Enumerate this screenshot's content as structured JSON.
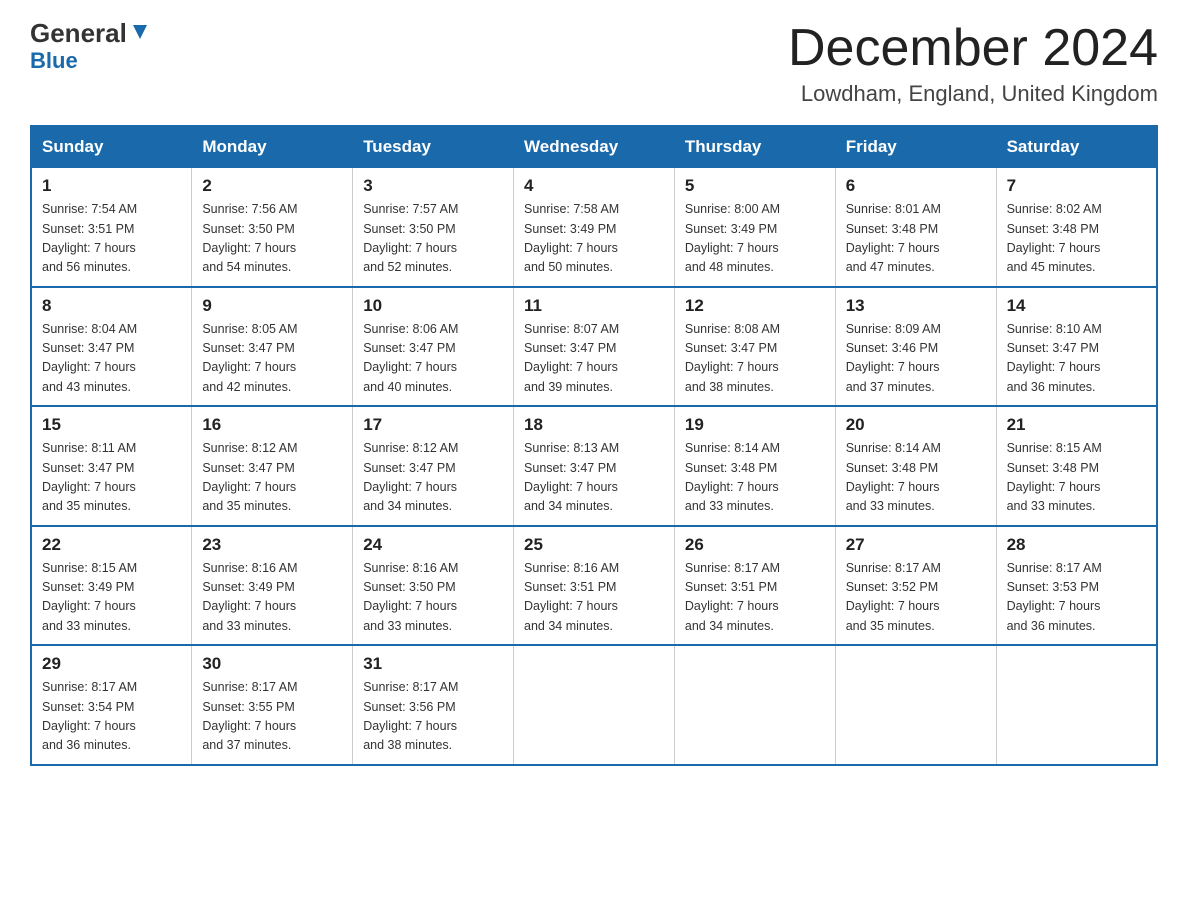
{
  "logo": {
    "line1_black": "General",
    "line1_blue": "Blue",
    "line2": "Blue"
  },
  "header": {
    "title": "December 2024",
    "subtitle": "Lowdham, England, United Kingdom"
  },
  "weekdays": [
    "Sunday",
    "Monday",
    "Tuesday",
    "Wednesday",
    "Thursday",
    "Friday",
    "Saturday"
  ],
  "weeks": [
    [
      {
        "day": "1",
        "info": "Sunrise: 7:54 AM\nSunset: 3:51 PM\nDaylight: 7 hours\nand 56 minutes."
      },
      {
        "day": "2",
        "info": "Sunrise: 7:56 AM\nSunset: 3:50 PM\nDaylight: 7 hours\nand 54 minutes."
      },
      {
        "day": "3",
        "info": "Sunrise: 7:57 AM\nSunset: 3:50 PM\nDaylight: 7 hours\nand 52 minutes."
      },
      {
        "day": "4",
        "info": "Sunrise: 7:58 AM\nSunset: 3:49 PM\nDaylight: 7 hours\nand 50 minutes."
      },
      {
        "day": "5",
        "info": "Sunrise: 8:00 AM\nSunset: 3:49 PM\nDaylight: 7 hours\nand 48 minutes."
      },
      {
        "day": "6",
        "info": "Sunrise: 8:01 AM\nSunset: 3:48 PM\nDaylight: 7 hours\nand 47 minutes."
      },
      {
        "day": "7",
        "info": "Sunrise: 8:02 AM\nSunset: 3:48 PM\nDaylight: 7 hours\nand 45 minutes."
      }
    ],
    [
      {
        "day": "8",
        "info": "Sunrise: 8:04 AM\nSunset: 3:47 PM\nDaylight: 7 hours\nand 43 minutes."
      },
      {
        "day": "9",
        "info": "Sunrise: 8:05 AM\nSunset: 3:47 PM\nDaylight: 7 hours\nand 42 minutes."
      },
      {
        "day": "10",
        "info": "Sunrise: 8:06 AM\nSunset: 3:47 PM\nDaylight: 7 hours\nand 40 minutes."
      },
      {
        "day": "11",
        "info": "Sunrise: 8:07 AM\nSunset: 3:47 PM\nDaylight: 7 hours\nand 39 minutes."
      },
      {
        "day": "12",
        "info": "Sunrise: 8:08 AM\nSunset: 3:47 PM\nDaylight: 7 hours\nand 38 minutes."
      },
      {
        "day": "13",
        "info": "Sunrise: 8:09 AM\nSunset: 3:46 PM\nDaylight: 7 hours\nand 37 minutes."
      },
      {
        "day": "14",
        "info": "Sunrise: 8:10 AM\nSunset: 3:47 PM\nDaylight: 7 hours\nand 36 minutes."
      }
    ],
    [
      {
        "day": "15",
        "info": "Sunrise: 8:11 AM\nSunset: 3:47 PM\nDaylight: 7 hours\nand 35 minutes."
      },
      {
        "day": "16",
        "info": "Sunrise: 8:12 AM\nSunset: 3:47 PM\nDaylight: 7 hours\nand 35 minutes."
      },
      {
        "day": "17",
        "info": "Sunrise: 8:12 AM\nSunset: 3:47 PM\nDaylight: 7 hours\nand 34 minutes."
      },
      {
        "day": "18",
        "info": "Sunrise: 8:13 AM\nSunset: 3:47 PM\nDaylight: 7 hours\nand 34 minutes."
      },
      {
        "day": "19",
        "info": "Sunrise: 8:14 AM\nSunset: 3:48 PM\nDaylight: 7 hours\nand 33 minutes."
      },
      {
        "day": "20",
        "info": "Sunrise: 8:14 AM\nSunset: 3:48 PM\nDaylight: 7 hours\nand 33 minutes."
      },
      {
        "day": "21",
        "info": "Sunrise: 8:15 AM\nSunset: 3:48 PM\nDaylight: 7 hours\nand 33 minutes."
      }
    ],
    [
      {
        "day": "22",
        "info": "Sunrise: 8:15 AM\nSunset: 3:49 PM\nDaylight: 7 hours\nand 33 minutes."
      },
      {
        "day": "23",
        "info": "Sunrise: 8:16 AM\nSunset: 3:49 PM\nDaylight: 7 hours\nand 33 minutes."
      },
      {
        "day": "24",
        "info": "Sunrise: 8:16 AM\nSunset: 3:50 PM\nDaylight: 7 hours\nand 33 minutes."
      },
      {
        "day": "25",
        "info": "Sunrise: 8:16 AM\nSunset: 3:51 PM\nDaylight: 7 hours\nand 34 minutes."
      },
      {
        "day": "26",
        "info": "Sunrise: 8:17 AM\nSunset: 3:51 PM\nDaylight: 7 hours\nand 34 minutes."
      },
      {
        "day": "27",
        "info": "Sunrise: 8:17 AM\nSunset: 3:52 PM\nDaylight: 7 hours\nand 35 minutes."
      },
      {
        "day": "28",
        "info": "Sunrise: 8:17 AM\nSunset: 3:53 PM\nDaylight: 7 hours\nand 36 minutes."
      }
    ],
    [
      {
        "day": "29",
        "info": "Sunrise: 8:17 AM\nSunset: 3:54 PM\nDaylight: 7 hours\nand 36 minutes."
      },
      {
        "day": "30",
        "info": "Sunrise: 8:17 AM\nSunset: 3:55 PM\nDaylight: 7 hours\nand 37 minutes."
      },
      {
        "day": "31",
        "info": "Sunrise: 8:17 AM\nSunset: 3:56 PM\nDaylight: 7 hours\nand 38 minutes."
      },
      {
        "day": "",
        "info": ""
      },
      {
        "day": "",
        "info": ""
      },
      {
        "day": "",
        "info": ""
      },
      {
        "day": "",
        "info": ""
      }
    ]
  ]
}
